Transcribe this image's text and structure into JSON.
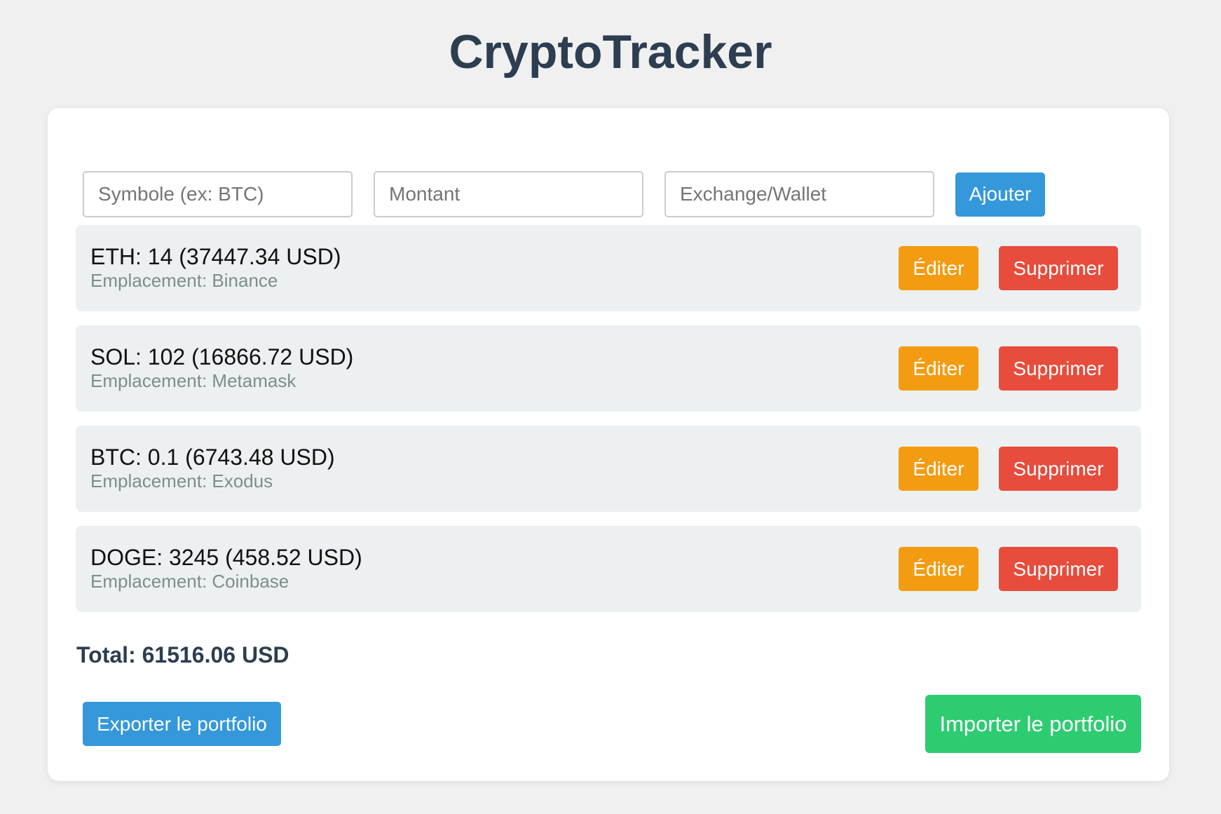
{
  "app": {
    "title": "CryptoTracker"
  },
  "form": {
    "symbol_placeholder": "Symbole (ex: BTC)",
    "amount_placeholder": "Montant",
    "location_placeholder": "Exchange/Wallet",
    "add_label": "Ajouter"
  },
  "holdings": [
    {
      "summary": "ETH: 14 (37447.34 USD)",
      "location": "Emplacement: Binance",
      "edit_label": "Éditer",
      "delete_label": "Supprimer"
    },
    {
      "summary": "SOL: 102 (16866.72 USD)",
      "location": "Emplacement: Metamask",
      "edit_label": "Éditer",
      "delete_label": "Supprimer"
    },
    {
      "summary": "BTC: 0.1 (6743.48 USD)",
      "location": "Emplacement: Exodus",
      "edit_label": "Éditer",
      "delete_label": "Supprimer"
    },
    {
      "summary": "DOGE: 3245 (458.52 USD)",
      "location": "Emplacement: Coinbase",
      "edit_label": "Éditer",
      "delete_label": "Supprimer"
    }
  ],
  "total": {
    "text": "Total: 61516.06 USD"
  },
  "actions": {
    "export_label": "Exporter le portfolio",
    "import_label": "Importer le portfolio"
  },
  "colors": {
    "page_background": "#f0f0f0",
    "title": "#2c3e50",
    "primary": "#3498db",
    "edit": "#f39c12",
    "delete": "#e74c3c",
    "import": "#2ecc71",
    "row_background": "#ecf0f1"
  }
}
